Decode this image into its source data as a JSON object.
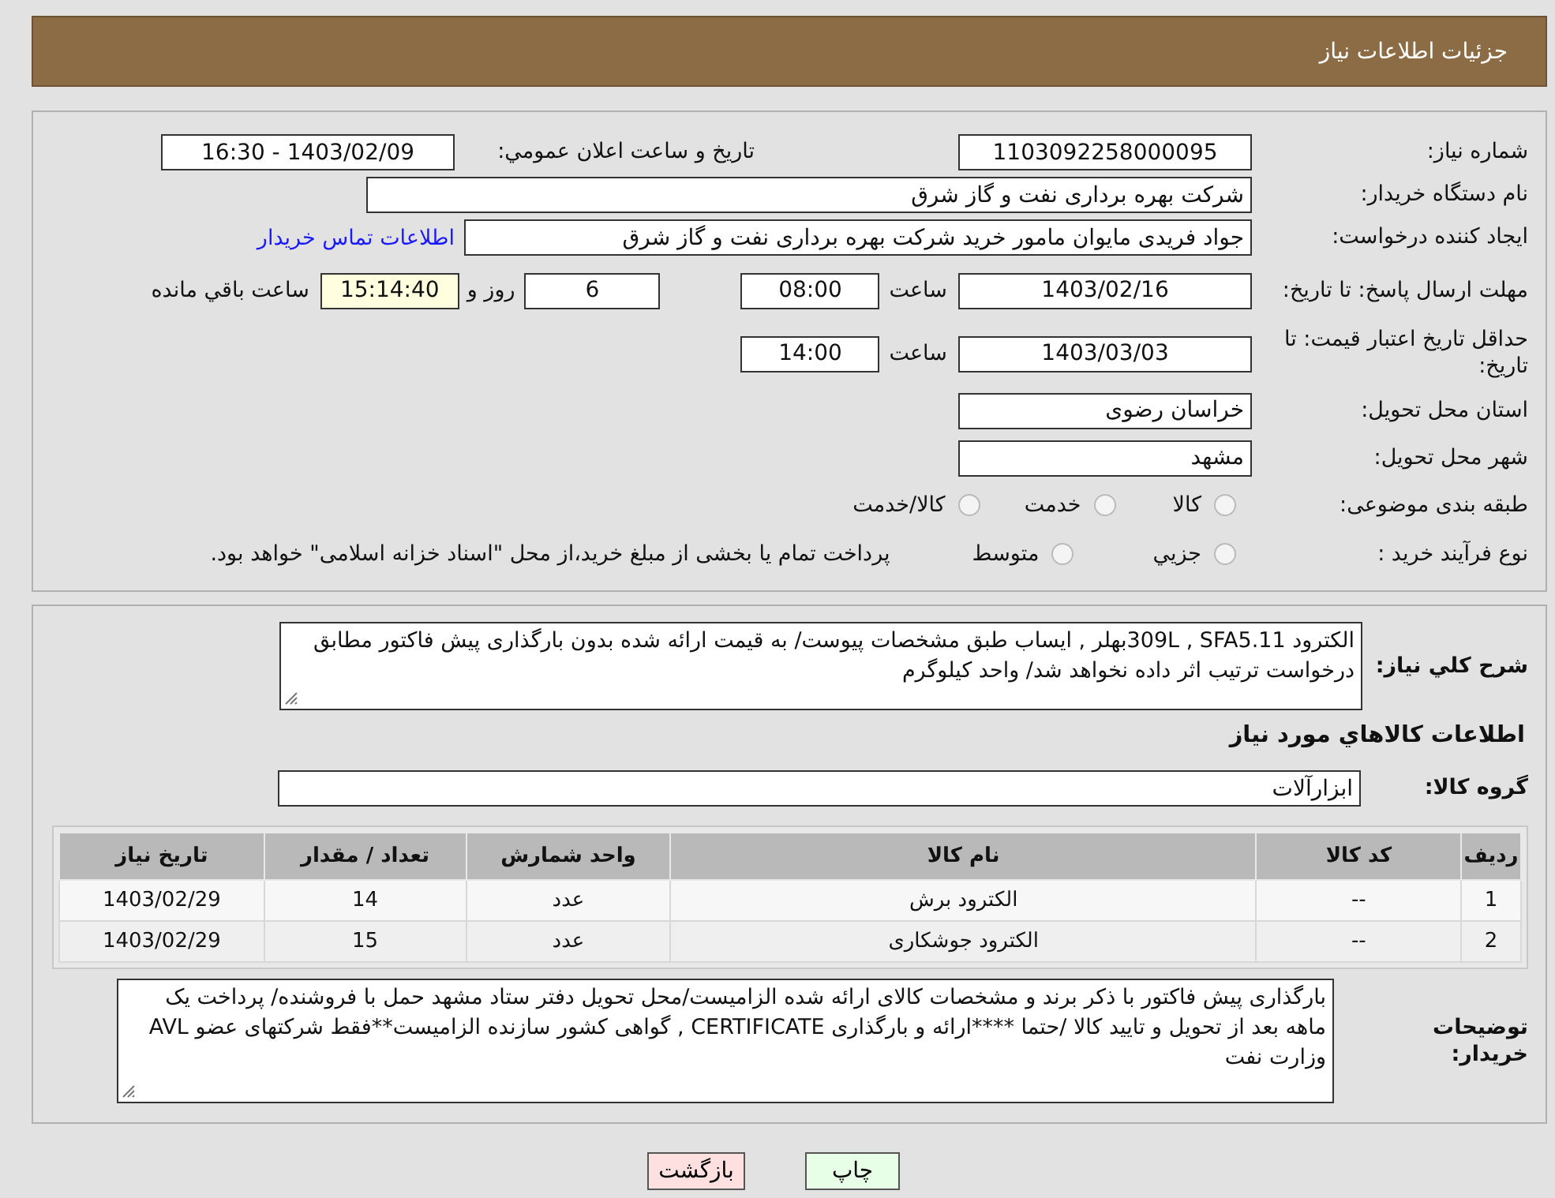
{
  "header": {
    "title": "جزئیات اطلاعات نیاز"
  },
  "need_number": {
    "label": "شماره نیاز:",
    "value": "1103092258000095"
  },
  "announce": {
    "label": "تاريخ و ساعت اعلان عمومي:",
    "value": "1403/02/09 - 16:30"
  },
  "buyer": {
    "label": "نام دستگاه خريدار:",
    "value": "شرکت بهره برداری نفت و گاز شرق"
  },
  "requester": {
    "label": "ايجاد کننده درخواست:",
    "value": "جواد فریدی مایوان مامور خرید شرکت بهره برداری نفت و گاز شرق",
    "link": "اطلاعات تماس خريدار"
  },
  "deadline": {
    "label": "مهلت ارسال پاسخ: تا تاریخ:",
    "date": "1403/02/16",
    "time_label": "ساعت",
    "time": "08:00",
    "days": "6",
    "days_label": "روز و",
    "remaining": "15:14:40",
    "remaining_label": "ساعت باقي مانده"
  },
  "validity": {
    "label": "حداقل تاریخ اعتبار قیمت: تا تاریخ:",
    "date": "1403/03/03",
    "time_label": "ساعت",
    "time": "14:00"
  },
  "province": {
    "label": "استان محل تحویل:",
    "value": "خراسان رضوی"
  },
  "city": {
    "label": "شهر محل تحویل:",
    "value": "مشهد"
  },
  "category": {
    "label": "طبقه بندی موضوعی:",
    "options": [
      {
        "label": "کالا",
        "selected": false
      },
      {
        "label": "خدمت",
        "selected": false
      },
      {
        "label": "کالا/خدمت",
        "selected": false
      }
    ]
  },
  "process": {
    "label": "نوع فرآیند خرید :",
    "options": [
      {
        "label": "جزيي",
        "selected": false
      },
      {
        "label": "متوسط",
        "selected": false
      }
    ],
    "note": "پرداخت تمام یا بخشی از مبلغ خرید،از محل \"اسناد خزانه اسلامی\" خواهد بود."
  },
  "description": {
    "label": "شرح کلي نياز:",
    "value": "الکترود  309L , SFA5.11بهلر , ایساب طبق مشخصات پیوست/ به قیمت ارائه شده بدون بارگذاری پیش فاکتور مطابق درخواست ترتیب اثر داده نخواهد شد/ واحد کیلوگرم"
  },
  "items_title": "اطلاعات کالاهاي مورد نياز",
  "group": {
    "label": "گروه کالا:",
    "value": "ابزارآلات"
  },
  "table": {
    "columns": [
      "ردیف",
      "کد کالا",
      "نام کالا",
      "واحد شمارش",
      "تعداد / مقدار",
      "تاریخ نیاز"
    ],
    "rows": [
      [
        "1",
        "--",
        "الکترود برش",
        "عدد",
        "14",
        "1403/02/29"
      ],
      [
        "2",
        "--",
        "الکترود جوشکاری",
        "عدد",
        "15",
        "1403/02/29"
      ]
    ]
  },
  "buyer_notes": {
    "label": "توضيحات خريدار:",
    "value": "بارگذاری پیش فاکتور با ذکر برند و مشخصات کالای ارائه شده الزامیست/محل تحویل دفتر ستاد مشهد حمل با فروشنده/ پرداخت یک ماهه بعد از تحویل و تایید کالا /حتما ****ارائه و بارگذاری CERTIFICATE , گواهی کشور سازنده الزامیست**فقط شرکتهای عضو AVL وزارت نفت"
  },
  "buttons": [
    {
      "label": "چاپ",
      "kind": "print"
    },
    {
      "label": "بازگشت",
      "kind": "back"
    }
  ]
}
